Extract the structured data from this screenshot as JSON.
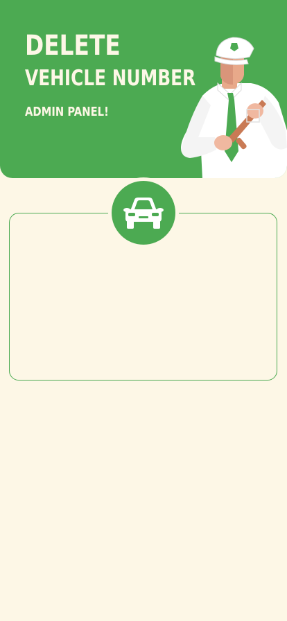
{
  "header": {
    "title_line1": "DELETE",
    "title_line2": "VEHICLE NUMBER",
    "subtitle": "ADMIN PANEL!"
  },
  "illustration": {
    "icon": "traffic-officer-illustration"
  },
  "badge": {
    "icon": "car-icon"
  },
  "colors": {
    "brand_green": "#4caa52",
    "background": "#fdf7e6",
    "text_on_green": "#fdf7e6"
  }
}
